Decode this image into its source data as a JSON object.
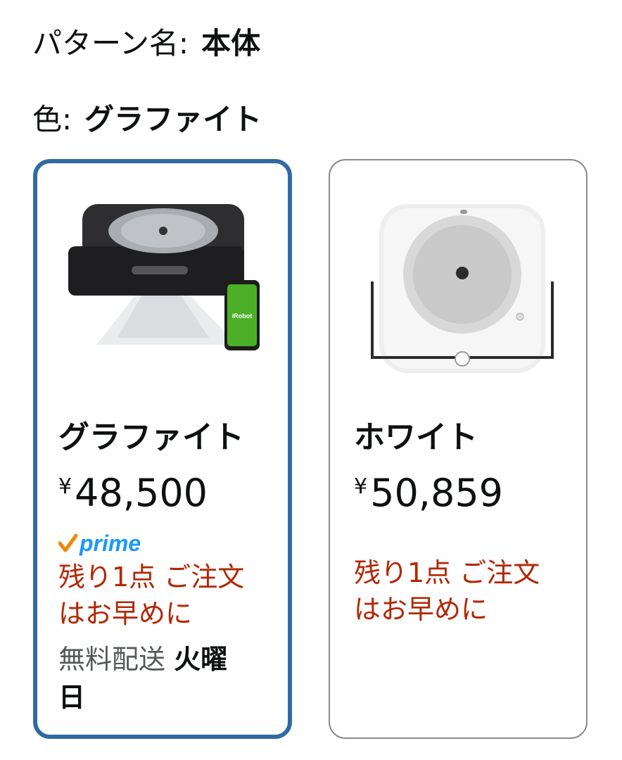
{
  "pattern": {
    "label": "パターン名:",
    "value": "本体"
  },
  "color": {
    "label": "色:",
    "value": "グラファイト"
  },
  "swatches": [
    {
      "name": "グラファイト",
      "currency": "¥",
      "price": "48,500",
      "prime_label": "prime",
      "stock_line1": "残り1点 ご注文",
      "stock_line2": "はお早めに",
      "delivery_prefix": "無料配送 ",
      "delivery_day_part1": "火曜",
      "delivery_day_part2": "日",
      "selected": true,
      "phone_brand": "iRobot"
    },
    {
      "name": "ホワイト",
      "currency": "¥",
      "price": "50,859",
      "stock_line1": "残り1点 ご注文",
      "stock_line2": "はお早めに",
      "selected": false
    }
  ],
  "colors": {
    "selected_border": "#2f6aa3",
    "unselected_border": "#8a8a8a",
    "stock_red": "#b12704",
    "prime_blue": "#1a98ff",
    "prime_orange": "#f08804"
  }
}
